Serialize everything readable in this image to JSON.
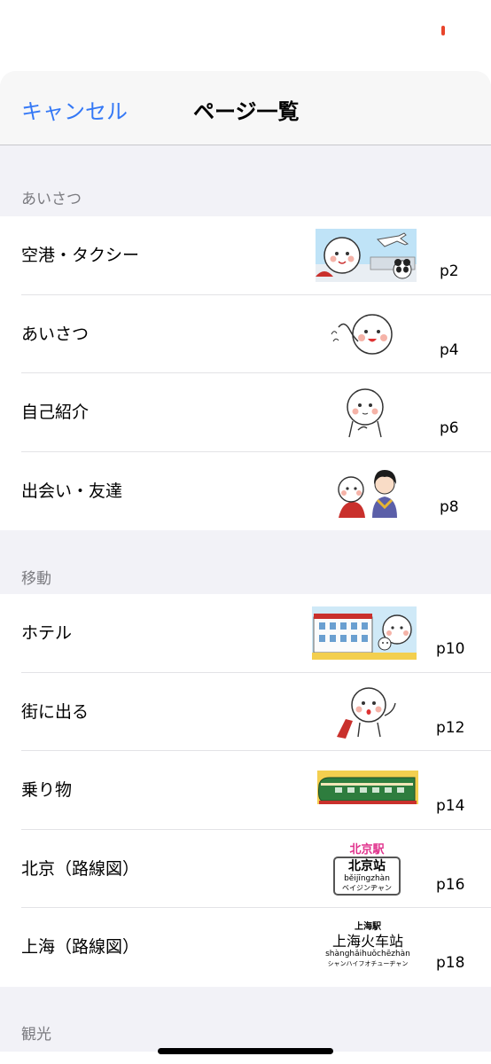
{
  "navbar": {
    "cancel_label": "キャンセル",
    "title": "ページ一覧"
  },
  "sections": [
    {
      "header": "あいさつ",
      "items": [
        {
          "label": "空港・タクシー",
          "page": "p2",
          "thumb": "airport-character-panda"
        },
        {
          "label": "あいさつ",
          "page": "p4",
          "thumb": "waving-character"
        },
        {
          "label": "自己紹介",
          "page": "p6",
          "thumb": "thinking-character"
        },
        {
          "label": "出会い・友達",
          "page": "p8",
          "thumb": "meeting-friend-character"
        }
      ]
    },
    {
      "header": "移動",
      "items": [
        {
          "label": "ホテル",
          "page": "p10",
          "thumb": "hotel-character"
        },
        {
          "label": "街に出る",
          "page": "p12",
          "thumb": "walking-character"
        },
        {
          "label": "乗り物",
          "page": "p14",
          "thumb": "green-train"
        },
        {
          "label": "北京（路線図）",
          "page": "p16",
          "thumb": "beijing-station-sign",
          "sign": {
            "top": "北京駅",
            "main": "北京站",
            "pinyin": "běijīngzhàn",
            "kana": "ベイジンヂャン"
          }
        },
        {
          "label": "上海（路線図）",
          "page": "p18",
          "thumb": "shanghai-station-sign",
          "sign": {
            "top": "上海駅",
            "main": "上海火车站",
            "pinyin": "shànghǎihuǒchēzhàn",
            "kana": "シャンハイフオチューヂャン"
          }
        }
      ]
    },
    {
      "header": "観光",
      "items": []
    }
  ],
  "colors": {
    "accent": "#3478f6",
    "battery": "#e8452c"
  }
}
